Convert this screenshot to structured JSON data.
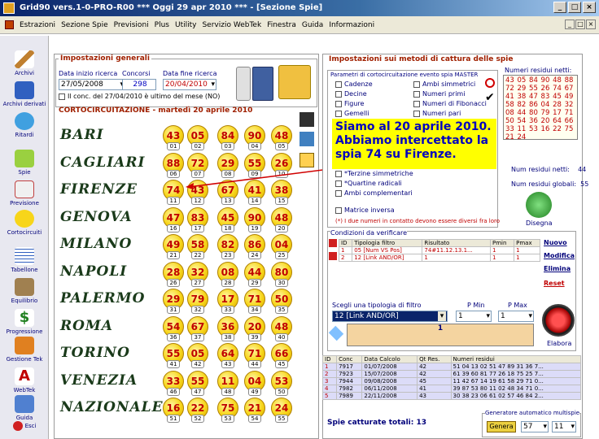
{
  "window": {
    "title": "Grid90 vers.1-0-PRO-R00  ***  Oggi 29 apr 2010  ***  - [Sezione Spie]"
  },
  "menu": [
    "Estrazioni",
    "Sezione Spie",
    "Previsioni",
    "Plus",
    "Utility",
    "Servizio WebTek",
    "Finestra",
    "Guida",
    "Informazioni"
  ],
  "sidebar": [
    {
      "label": "Archivi",
      "icon": "pencil-icon"
    },
    {
      "label": "Archivi derivati",
      "icon": "archive-icon"
    },
    {
      "label": "Ritardi",
      "icon": "clock-icon"
    },
    {
      "label": "Spie",
      "icon": "spyglass-icon"
    },
    {
      "label": "Previsione",
      "icon": "checklist-icon"
    },
    {
      "label": "Cortocircuiti",
      "icon": "lightbulb-icon"
    },
    {
      "label": "Tabellone",
      "icon": "grid-icon"
    },
    {
      "label": "Equilibrio",
      "icon": "scale-icon"
    },
    {
      "label": "Progressione",
      "icon": "dollar-icon"
    },
    {
      "label": "Gestione Tek",
      "icon": "tools-icon"
    },
    {
      "label": "WebTek",
      "icon": "webtek-icon"
    },
    {
      "label": "Guida",
      "icon": "guide-icon"
    },
    {
      "label": "Esci",
      "icon": "exit-icon"
    }
  ],
  "settings": {
    "title": "Impostazioni generali",
    "start_label": "Data inizio ricerca",
    "start_value": "27/05/2008",
    "draws_label": "Concorsi",
    "draws_value": "298",
    "end_label": "Data fine ricerca",
    "end_value": "20/04/2010",
    "note": "Il conc. del 27/04/2010 è ultimo del mese (NO)"
  },
  "circuit": {
    "title": "CORTOCIRCUITAZIONE - martedì 20 aprile 2010",
    "wheels": [
      {
        "name": "BARI",
        "nums": [
          "43",
          "05",
          "84",
          "90",
          "48"
        ],
        "pos": [
          "01",
          "02",
          "03",
          "04",
          "05"
        ]
      },
      {
        "name": "CAGLIARI",
        "nums": [
          "88",
          "72",
          "29",
          "55",
          "26"
        ],
        "pos": [
          "06",
          "07",
          "08",
          "09",
          "10"
        ]
      },
      {
        "name": "FIRENZE",
        "nums": [
          "74",
          "43",
          "67",
          "41",
          "38"
        ],
        "pos": [
          "11",
          "12",
          "13",
          "14",
          "15"
        ]
      },
      {
        "name": "GENOVA",
        "nums": [
          "47",
          "83",
          "45",
          "90",
          "48"
        ],
        "pos": [
          "16",
          "17",
          "18",
          "19",
          "20"
        ]
      },
      {
        "name": "MILANO",
        "nums": [
          "49",
          "58",
          "82",
          "86",
          "04"
        ],
        "pos": [
          "21",
          "22",
          "23",
          "24",
          "25"
        ]
      },
      {
        "name": "NAPOLI",
        "nums": [
          "28",
          "32",
          "08",
          "44",
          "80"
        ],
        "pos": [
          "26",
          "27",
          "28",
          "29",
          "30"
        ]
      },
      {
        "name": "PALERMO",
        "nums": [
          "29",
          "79",
          "17",
          "71",
          "50"
        ],
        "pos": [
          "31",
          "32",
          "33",
          "34",
          "35"
        ]
      },
      {
        "name": "ROMA",
        "nums": [
          "54",
          "67",
          "36",
          "20",
          "48"
        ],
        "pos": [
          "36",
          "37",
          "38",
          "39",
          "40"
        ]
      },
      {
        "name": "TORINO",
        "nums": [
          "55",
          "05",
          "64",
          "71",
          "66"
        ],
        "pos": [
          "41",
          "42",
          "43",
          "44",
          "45"
        ]
      },
      {
        "name": "VENEZIA",
        "nums": [
          "33",
          "55",
          "11",
          "04",
          "53"
        ],
        "pos": [
          "46",
          "47",
          "48",
          "49",
          "50"
        ]
      },
      {
        "name": "NAZIONALE",
        "nums": [
          "16",
          "22",
          "75",
          "21",
          "24"
        ],
        "pos": [
          "51",
          "52",
          "53",
          "54",
          "55"
        ]
      }
    ]
  },
  "methods": {
    "title": "Impostazioni sui metodi di cattura delle spie",
    "params_title": "Parametri di cortocircuitazione evento spia MASTER",
    "col1": [
      "Cadenze",
      "Decine",
      "Figure",
      "Gemelli"
    ],
    "col2": [
      "Ambi simmetrici",
      "Numeri primi",
      "Numeri di Fibonacci",
      "Numeri pari"
    ],
    "extra": [
      "Terzine simmetriche",
      "Quartine radicali",
      "Ambi complementari"
    ],
    "matrix": "Matrice inversa",
    "footnote": "(*) I due numeri in contatto devono essere diversi fra loro"
  },
  "callout": "Siamo al 20 aprile 2010. Abbiamo intercettato la spia 74 su Firenze.",
  "residui": {
    "title": "Numeri residui netti:",
    "numbers": "43 05 84 90 48 88 72 29 55 26 74 67 41 38 47 83 45 49 58 82 86 04 28 32 08 44 80 79 17 71 50 54 36 20 64 66 33 11 53 16 22 75 21 24",
    "netti_label": "Num residui netti:",
    "netti_value": "44",
    "global_label": "Num residui globali:",
    "global_value": "55",
    "draw_label": "Disegna"
  },
  "conditions": {
    "title": "Condizioni da verificare",
    "headers": [
      "ID",
      "Tipologia filtro",
      "Risultato",
      "Pmin",
      "Pmax"
    ],
    "rows": [
      [
        "1",
        "05 [Num VS Pos]",
        "74#11.12.13.1...",
        "1",
        "1"
      ],
      [
        "2",
        "12 [Link AND/OR]",
        "1",
        "1",
        "1"
      ]
    ],
    "actions": [
      "Nuovo",
      "Modifica",
      "Elimina",
      "Reset"
    ],
    "filter_label": "Scegli una tipologia di filtro",
    "filter_value": "12 [Link AND/OR]",
    "pmin_label": "P Min",
    "pmin_value": "1",
    "pmax_label": "P Max",
    "pmax_value": "1",
    "result_value": "1",
    "elabora": "Elabora"
  },
  "results": {
    "headers": [
      "ID",
      "Conc",
      "Data Calcolo",
      "Qt Res.",
      "Numeri residui"
    ],
    "rows": [
      [
        "1",
        "7917",
        "01/07/2008",
        "42",
        "51 04 13 02 51 47 89 31 36 7..."
      ],
      [
        "2",
        "7923",
        "15/07/2008",
        "42",
        "61 39 60 81 77 26 18 75 25 7..."
      ],
      [
        "3",
        "7944",
        "09/08/2008",
        "45",
        "11 42 67 14 19 61 58 29 71 0..."
      ],
      [
        "4",
        "7982",
        "06/11/2008",
        "41",
        "39 87 53 80 11 02 48 34 71 0..."
      ],
      [
        "5",
        "7989",
        "22/11/2008",
        "43",
        "30 38 23 06 61 02 57 46 84 2..."
      ]
    ],
    "total": "Spie catturate totali: 13",
    "auto_title": "Generatore automatico multispie",
    "gen_button": "Genera",
    "sel1": "57",
    "sel2": "11"
  }
}
